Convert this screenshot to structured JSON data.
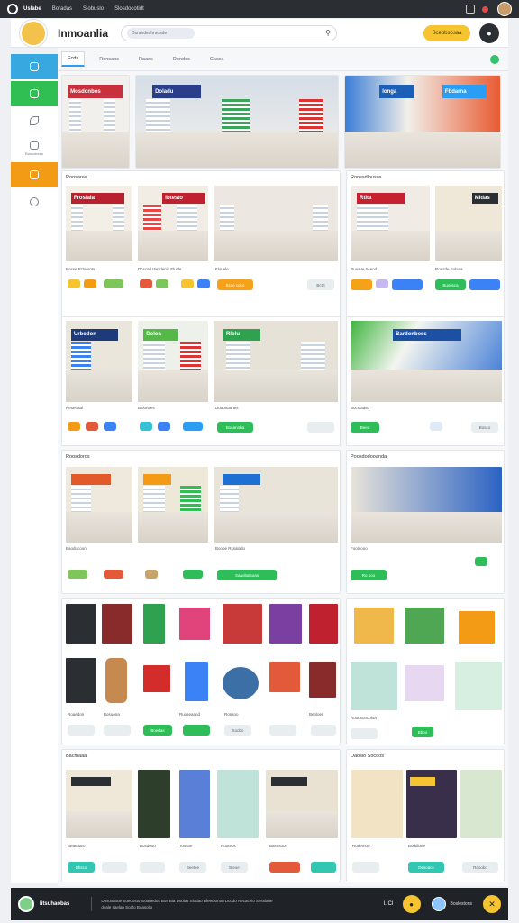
{
  "topbar": {
    "brand": "Uslabe",
    "links": [
      "Boradas",
      "Slobuslo",
      "Slosdocotidt"
    ]
  },
  "header": {
    "title": "Inmoanlia",
    "search_pill": "Dsrandeshmosde",
    "cta_label": "Sceobsosaa"
  },
  "sidebar": {
    "items": [
      {
        "label": "",
        "color": "#37a8e0"
      },
      {
        "label": "",
        "color": "#2fbf52"
      },
      {
        "label": "",
        "color": "#ffffff"
      },
      {
        "label": "Bosodesos",
        "color": "#ffffff"
      },
      {
        "label": "",
        "color": "#f39b15"
      },
      {
        "label": "",
        "color": "#ffffff"
      }
    ]
  },
  "tabs": [
    "Ecds",
    "Ronsaos",
    "Raaos",
    "Dondos",
    "Cacsa"
  ],
  "sections": {
    "s1": "Roosaraa",
    "s2": "Roossdlousas",
    "s3": "Roosdoros",
    "s4": "Poosdodooanda",
    "s5": "Bacmaaa",
    "s6": "Daoslo Socdos"
  },
  "store_signs": [
    "Mosdonbos",
    "Doladu",
    "Ionga",
    "Fbdarna",
    "Froslaia",
    "Ibtesto",
    "Rtlta",
    "Midas",
    "Urbodon",
    "Doloa",
    "Rlolu",
    "Bardonbess"
  ],
  "row2": {
    "labels": [
      "Bosse Bctelunts",
      "Dcscsd Vanclenic Flucle",
      "Flouele",
      "Ruosve Sceod",
      "Ronsde Solsea"
    ],
    "buttons": [
      "Bcce cdco",
      "Bctrt",
      "Busosca"
    ]
  },
  "row3": {
    "labels": [
      "Reseoaal",
      "Bloonaes",
      "Doaonaunes",
      "Bocsotaso"
    ],
    "buttons": [
      "Bosannba",
      "Bosco",
      "Beeo"
    ]
  },
  "row4": {
    "labels": [
      "Baoducoon",
      "Boooe Rssalado",
      "Fooloooo"
    ],
    "buttons": [
      "Saaobalsoas",
      "Ro ooo"
    ]
  },
  "row5": {
    "labels": [
      "Roaedon",
      "Bosuona",
      "Ruoseaand",
      "Ronsoo",
      "Beoloer",
      "Roodsoncoloa"
    ],
    "buttons": [
      "Boedas",
      "Sodco",
      "Bbbo"
    ]
  },
  "row6": {
    "labels": [
      "Beaeoaro",
      "Bosdooo",
      "Toosoe",
      "Ruoteos",
      "Basosoon",
      "Roaemoo",
      "Boddloee"
    ],
    "buttons": [
      "Dbsco",
      "Beetee",
      "Bleoe",
      "Desoacs",
      "Raoobo"
    ]
  },
  "bottombar": {
    "name": "Iitsuhaobas",
    "text": "Dosoxaoue Soeoosto Iooauedos Bos Bla Dsolas Slodao Bfeedsmon Dccdo Recacelo Sesslaoe doale saelan Soalo Boasolio",
    "number": "I.ICI",
    "name2": "Boslestons"
  },
  "colors": {
    "accent_blue": "#2a9df4",
    "green": "#2ebd59",
    "orange": "#f6a11a",
    "yellow": "#f6c431",
    "dark": "#2b2e33"
  }
}
